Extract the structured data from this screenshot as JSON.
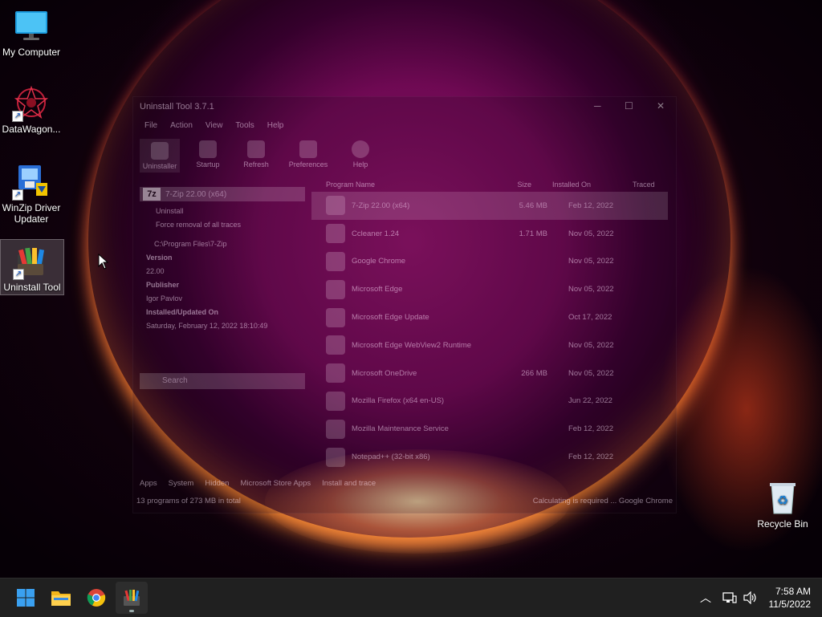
{
  "desktop": {
    "icons": [
      {
        "label": "My Computer",
        "icon": "monitor-icon"
      },
      {
        "label": "DataWagon...",
        "icon": "datawagon-icon"
      },
      {
        "label": "WinZip Driver Updater",
        "icon": "winzip-driver-updater-icon"
      },
      {
        "label": "Uninstall Tool",
        "icon": "uninstall-tool-icon"
      },
      {
        "label": "Recycle Bin",
        "icon": "recycle-bin-icon"
      }
    ]
  },
  "window": {
    "title": "Uninstall Tool 3.7.1",
    "menu": [
      "File",
      "Action",
      "View",
      "Tools",
      "Help"
    ],
    "toolbar": [
      "Uninstaller",
      "Startup",
      "Refresh",
      "Preferences",
      "Help"
    ],
    "selected_app": {
      "icon_text": "7z",
      "name": "7-Zip 22.00 (x64)",
      "uninstall": "Uninstall",
      "force": "Force removal of all traces",
      "path": "C:\\Program Files\\7-Zip",
      "version_label": "Version",
      "version": "22.00",
      "publisher_label": "Publisher",
      "publisher": "Igor Pavlov",
      "installed_label": "Installed/Updated On",
      "installed": "Saturday, February 12, 2022 18:10:49"
    },
    "search_placeholder": "Search",
    "columns": [
      "Program Name",
      "Size",
      "Installed On",
      "Traced"
    ],
    "programs": [
      {
        "name": "7-Zip 22.00 (x64)",
        "size": "5.46 MB",
        "date": "Feb 12, 2022"
      },
      {
        "name": "Ccleaner 1.24",
        "size": "1.71 MB",
        "date": "Nov 05, 2022"
      },
      {
        "name": "Google Chrome",
        "size": "",
        "date": "Nov 05, 2022"
      },
      {
        "name": "Microsoft Edge",
        "size": "",
        "date": "Nov 05, 2022"
      },
      {
        "name": "Microsoft Edge Update",
        "size": "",
        "date": "Oct 17, 2022"
      },
      {
        "name": "Microsoft Edge WebView2 Runtime",
        "size": "",
        "date": "Nov 05, 2022"
      },
      {
        "name": "Microsoft OneDrive",
        "size": "266 MB",
        "date": "Nov 05, 2022"
      },
      {
        "name": "Mozilla Firefox (x64 en-US)",
        "size": "",
        "date": "Jun 22, 2022"
      },
      {
        "name": "Mozilla Maintenance Service",
        "size": "",
        "date": "Feb 12, 2022"
      },
      {
        "name": "Notepad++ (32-bit x86)",
        "size": "",
        "date": "Feb 12, 2022"
      }
    ],
    "filters": [
      "Apps",
      "System",
      "Hidden",
      "Microsoft Store Apps",
      "Install and trace"
    ],
    "status_left": "13 programs of 273 MB in total",
    "status_right": "Calculating is required ... Google Chrome"
  },
  "taskbar": {
    "apps": [
      "start-icon",
      "file-explorer-icon",
      "chrome-icon",
      "uninstall-tool-icon"
    ],
    "time": "7:58 AM",
    "date": "11/5/2022"
  }
}
